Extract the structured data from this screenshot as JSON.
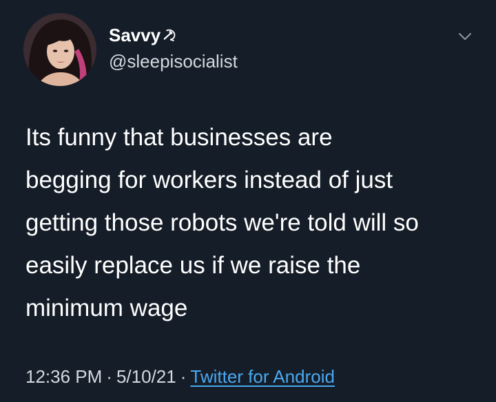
{
  "tweet": {
    "author": {
      "display_name": "Savvy",
      "name_emoji": "hammer-and-sickle-icon",
      "handle": "@sleepisocialist"
    },
    "text": "Its funny that businesses are\nbegging for workers instead of just\ngetting those robots we're told will so\neasily replace us if we raise the\nminimum wage",
    "time": "12:36 PM",
    "separator": "·",
    "date": "5/10/21",
    "source": "Twitter for Android"
  },
  "icons": {
    "menu": "chevron-down-icon"
  },
  "colors": {
    "background": "#151d28",
    "text": "#ffffff",
    "secondary_text": "#d4d9de",
    "link": "#4aa8f0"
  }
}
